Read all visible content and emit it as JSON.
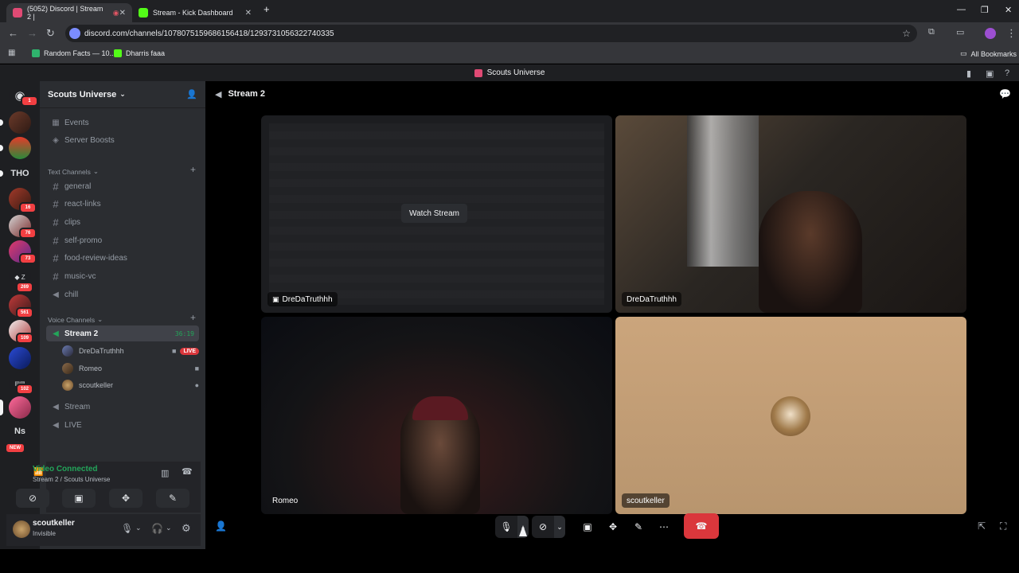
{
  "browser": {
    "tabs": [
      {
        "label": "(5052) Discord | Stream 2 |",
        "active": true
      },
      {
        "label": "Stream - Kick Dashboard",
        "active": false
      }
    ],
    "url": "discord.com/channels/1078075159686156418/1293731056322740335",
    "bookmarks": [
      "Random Facts — 10...",
      "Dharris faaa"
    ],
    "all_bookmarks": "All Bookmarks"
  },
  "discord": {
    "title": "Scouts Universe",
    "guild_badges": [
      "1",
      "16",
      "76",
      "73",
      "269",
      "561",
      "109",
      "102"
    ],
    "guild_text": [
      "THO",
      "Ns"
    ],
    "new_label": "NEW",
    "server_name": "Scouts Universe",
    "events": "Events",
    "boosts": "Server Boosts",
    "text_category": "Text Channels",
    "text_channels": [
      "general",
      "react-links",
      "clips",
      "self-promo",
      "food-review-ideas",
      "music-vc",
      "chill"
    ],
    "voice_category": "Voice Channels",
    "voice_channels": [
      {
        "name": "Stream 2",
        "timer": "36:19"
      },
      {
        "name": "Stream"
      },
      {
        "name": "LIVE"
      }
    ],
    "voice_users": [
      {
        "name": "DreDaTruthhh",
        "live": "LIVE"
      },
      {
        "name": "Romeo"
      },
      {
        "name": "scoutkeller"
      }
    ],
    "voice_status": {
      "title": "Video Connected",
      "subtitle": "Stream 2 / Scouts Universe"
    },
    "user": {
      "name": "scoutkeller",
      "status": "Invisible"
    },
    "main_header": "Stream 2",
    "tiles": [
      {
        "name": "DreDaTruthhh",
        "action": "Watch Stream"
      },
      {
        "name": "DreDaTruthhh"
      },
      {
        "name": "Romeo"
      },
      {
        "name": "scoutkeller"
      }
    ]
  },
  "colors": {
    "accent": "#5865f2",
    "live": "#da373c",
    "connected": "#23a55a",
    "hangup": "#da373c"
  }
}
